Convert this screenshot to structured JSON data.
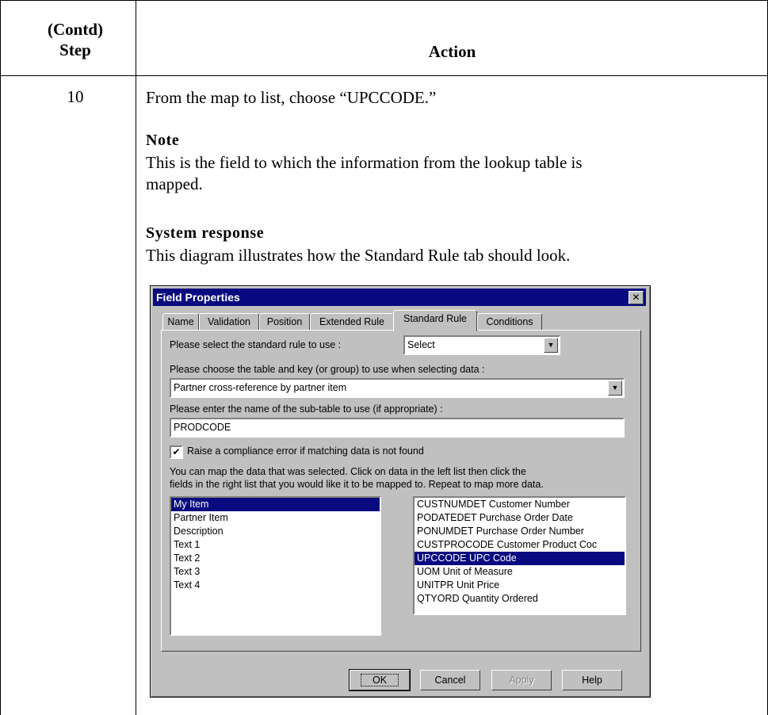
{
  "table": {
    "step_header_line1": "(Contd)",
    "step_header_line2": "Step",
    "action_header": "Action",
    "step_number": "10",
    "instruction": "From the map to list, choose “UPCCODE.”",
    "note_heading": "Note",
    "note_text_line1": "This is the field to which the information from the lookup table is",
    "note_text_line2": "mapped.",
    "response_heading": "System response",
    "response_text": "This diagram illustrates how the Standard Rule tab should look."
  },
  "dialog": {
    "title": "Field Properties",
    "close_glyph": "✕",
    "tabs": [
      "Name",
      "Validation",
      "Position",
      "Extended Rule",
      "Standard Rule",
      "Conditions"
    ],
    "active_tab": "Standard Rule",
    "rule_label": "Please select the standard rule to use :",
    "rule_value": "Select",
    "table_key_label": "Please choose the table and key (or group) to use when selecting data :",
    "table_key_value": "Partner cross-reference by partner item",
    "subtable_label": "Please enter the name of the sub-table to use (if appropriate) :",
    "subtable_value": "PRODCODE",
    "compliance_checked": true,
    "compliance_check_glyph": "✔",
    "compliance_label": "Raise a compliance error if matching data is not found",
    "map_instructions_line1": "You can map the data that was selected. Click on data in the left list then click the",
    "map_instructions_line2": "fields in the right list that you would like it to be mapped to. Repeat to map more data.",
    "left_list": [
      "My Item",
      "Partner Item",
      "Description",
      "Text 1",
      "Text 2",
      "Text 3",
      "Text 4"
    ],
    "left_selected": 0,
    "right_list": [
      "CUSTNUMDET Customer Number",
      "PODATEDET Purchase Order Date",
      "PONUMDET Purchase Order Number",
      "CUSTPROCODE Customer Product Coc",
      "UPCCODE UPC Code",
      "UOM Unit of Measure",
      "UNITPR Unit Price",
      "QTYORD Quantity Ordered"
    ],
    "right_selected": 4,
    "dropdown_glyph": "▼",
    "buttons": {
      "ok": "OK",
      "cancel": "Cancel",
      "apply": "Apply",
      "help": "Help"
    },
    "colors": {
      "titlebar": "#0a0a80",
      "face": "#c0c0c0",
      "selection": "#0a0a80"
    }
  }
}
